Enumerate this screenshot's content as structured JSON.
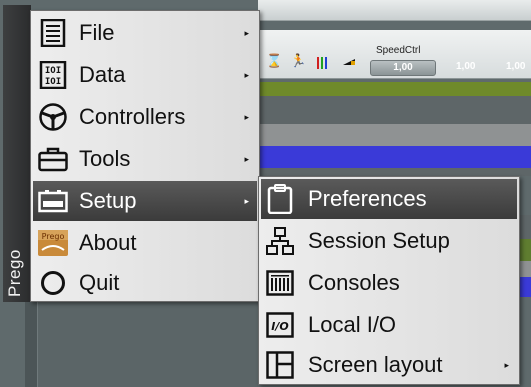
{
  "app": {
    "tab_label": "Prego"
  },
  "toolbar": {
    "speed_label": "SpeedCtrl",
    "speed_values": [
      "1,00",
      "1,00",
      "1,00"
    ]
  },
  "main_menu": {
    "items": [
      {
        "label": "File",
        "icon": "file-lines-icon",
        "submenu": true
      },
      {
        "label": "Data",
        "icon": "data-binary-icon",
        "submenu": true
      },
      {
        "label": "Controllers",
        "icon": "steering-wheel-icon",
        "submenu": true
      },
      {
        "label": "Tools",
        "icon": "toolbox-icon",
        "submenu": true
      },
      {
        "label": "Setup",
        "icon": "setup-panel-icon",
        "submenu": true,
        "active": true
      },
      {
        "label": "About",
        "icon": "prego-logo-icon",
        "submenu": false
      },
      {
        "label": "Quit",
        "icon": "circle-quit-icon",
        "submenu": false
      }
    ]
  },
  "setup_submenu": {
    "items": [
      {
        "label": "Preferences",
        "icon": "clipboard-icon",
        "active": true
      },
      {
        "label": "Session Setup",
        "icon": "network-tree-icon"
      },
      {
        "label": "Consoles",
        "icon": "console-grid-icon"
      },
      {
        "label": "Local I/O",
        "icon": "io-icon"
      },
      {
        "label": "Screen layout",
        "icon": "layout-split-icon",
        "submenu": true
      }
    ]
  },
  "colors": {
    "active_item": "#3b3b3b",
    "band_green": "#6f8a2a",
    "band_gray": "#8f9293",
    "band_blue": "#3a3ad8"
  }
}
